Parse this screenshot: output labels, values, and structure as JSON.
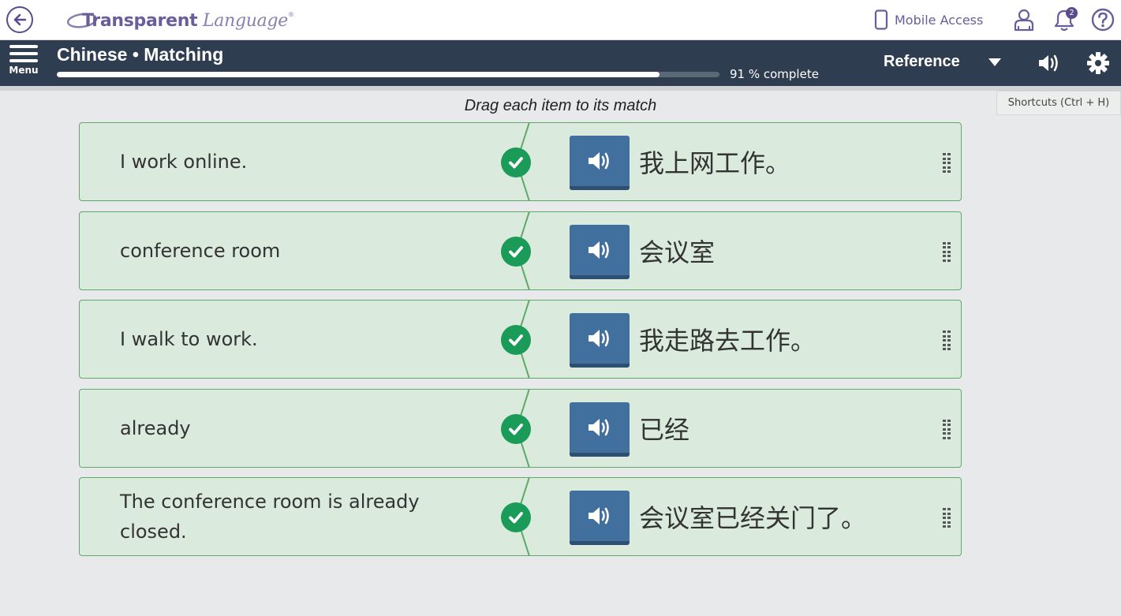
{
  "topbar": {
    "logo_bold": "Transparent",
    "logo_italic": "Language",
    "logo_mark": "®",
    "mobile_access": "Mobile Access",
    "notifications_count": "2",
    "icons": [
      "back-arrow-icon",
      "phone-icon",
      "user-icon",
      "bell-icon",
      "help-icon"
    ]
  },
  "navbar": {
    "menu_label": "Menu",
    "title": "Chinese • Matching",
    "progress_percent": 91,
    "progress_text": "91 % complete",
    "reference_label": "Reference",
    "icons": [
      "menu-icon",
      "caret-down-icon",
      "speaker-icon",
      "gear-icon"
    ]
  },
  "shortcuts_label": "Shortcuts (Ctrl + H)",
  "instruction": "Drag each item to its match",
  "rows": [
    {
      "english": "I work online.",
      "chinese": "我上网工作。",
      "matched": true
    },
    {
      "english": "conference room",
      "chinese": "会议室",
      "matched": true
    },
    {
      "english": "I walk to work.",
      "chinese": "我走路去工作。",
      "matched": true
    },
    {
      "english": "already",
      "chinese": "已经",
      "matched": true
    },
    {
      "english": "The conference room is already closed.",
      "chinese": "会议室已经关门了。",
      "matched": true
    }
  ],
  "colors": {
    "navbar_bg": "#2f3d51",
    "row_bg": "#daeadc",
    "row_border": "#5fa868",
    "check_green": "#1a9b57",
    "audio_blue": "#42709e",
    "brand_purple": "#6a5d9c"
  }
}
